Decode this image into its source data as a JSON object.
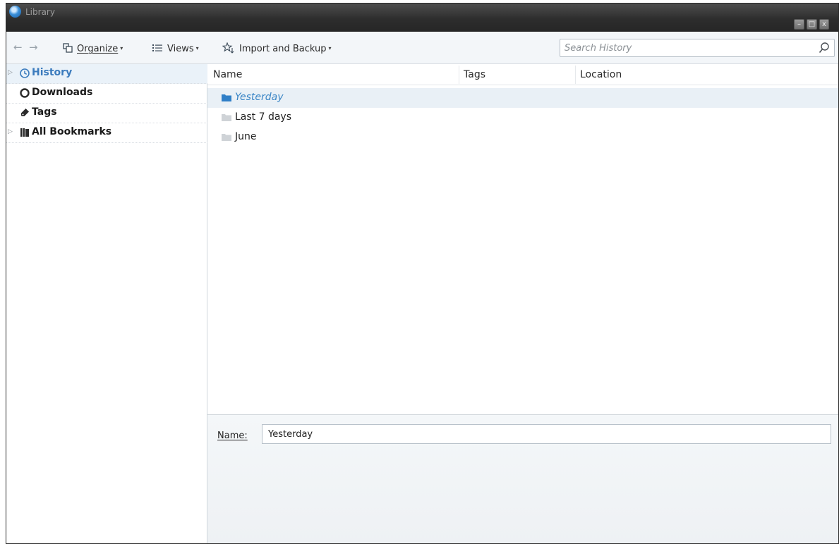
{
  "window": {
    "title": "Library",
    "buttons": {
      "minimize": "–",
      "maximize": "□",
      "close": "x"
    }
  },
  "toolbar": {
    "back_icon": "←",
    "forward_icon": "→",
    "organize_label": "Organize",
    "views_label": "Views",
    "import_label": "Import and Backup",
    "dropdown_glyph": "▾",
    "search_placeholder": "Search History"
  },
  "sidebar": {
    "items": [
      {
        "label": "History",
        "icon": "clock-icon",
        "has_twisty": true,
        "selected": true
      },
      {
        "label": "Downloads",
        "icon": "download-icon",
        "has_twisty": false,
        "selected": false
      },
      {
        "label": "Tags",
        "icon": "tag-icon",
        "has_twisty": false,
        "selected": false
      },
      {
        "label": "All Bookmarks",
        "icon": "bookmarks-icon",
        "has_twisty": true,
        "selected": false
      }
    ]
  },
  "table": {
    "columns": [
      "Name",
      "Tags",
      "Location"
    ],
    "rows": [
      {
        "name": "Yesterday",
        "selected": true
      },
      {
        "name": "Last 7 days",
        "selected": false
      },
      {
        "name": "June",
        "selected": false
      }
    ]
  },
  "details": {
    "name_label": "Name:",
    "name_value": "Yesterday"
  },
  "colors": {
    "accent": "#3b86c6",
    "selection_bg": "#e9f0f6",
    "folder_gray": "#c9cdd1",
    "folder_blue": "#2f7fc7"
  }
}
